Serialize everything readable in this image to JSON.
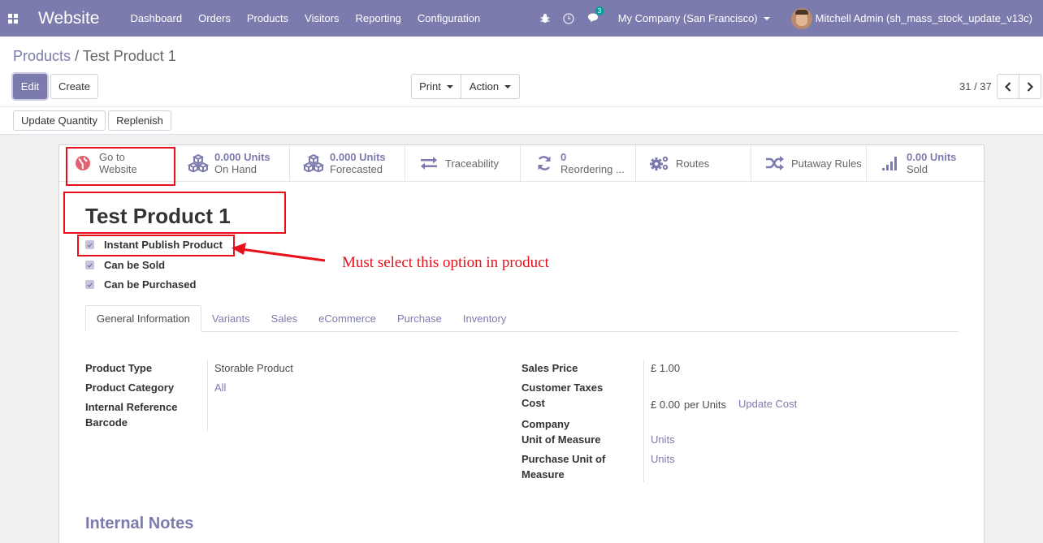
{
  "navbar": {
    "brand": "Website",
    "menu": [
      "Dashboard",
      "Orders",
      "Products",
      "Visitors",
      "Reporting",
      "Configuration"
    ],
    "chat_count": "3",
    "company": "My Company (San Francisco)",
    "user": "Mitchell Admin (sh_mass_stock_update_v13c)"
  },
  "breadcrumb": {
    "parent": "Products",
    "separator": "/",
    "current": "Test Product 1"
  },
  "toolbar": {
    "edit": "Edit",
    "create": "Create",
    "print": "Print",
    "action": "Action",
    "pager": "31 / 37",
    "update_quantity": "Update Quantity",
    "replenish": "Replenish"
  },
  "stats": [
    {
      "line1": "Go to",
      "line2": "Website",
      "icon": "globe-icon"
    },
    {
      "line1": "0.000 Units",
      "line2": "On Hand",
      "icon": "cubes-icon"
    },
    {
      "line1": "0.000 Units",
      "line2": "Forecasted",
      "icon": "cubes-icon"
    },
    {
      "line1": "Traceability",
      "line2": "",
      "icon": "exchange-icon"
    },
    {
      "line1": "0",
      "line2": "Reordering ...",
      "icon": "refresh-icon"
    },
    {
      "line1": "Routes",
      "line2": "",
      "icon": "cogs-icon"
    },
    {
      "line1": "Putaway Rules",
      "line2": "",
      "icon": "random-icon"
    },
    {
      "line1": "0.00 Units",
      "line2": "Sold",
      "icon": "signal-icon"
    }
  ],
  "product": {
    "name": "Test Product 1",
    "checkboxes": [
      "Instant Publish Product",
      "Can be Sold",
      "Can be Purchased"
    ]
  },
  "annotation": "Must select this option in product",
  "tabs": [
    "General Information",
    "Variants",
    "Sales",
    "eCommerce",
    "Purchase",
    "Inventory"
  ],
  "left_fields": {
    "product_type_label": "Product Type",
    "product_type": "Storable Product",
    "category_label": "Product Category",
    "category": "All",
    "internal_ref_label": "Internal Reference",
    "barcode_label": "Barcode"
  },
  "right_fields": {
    "sales_price_label": "Sales Price",
    "sales_price": "£ 1.00",
    "customer_taxes_label": "Customer Taxes",
    "cost_label": "Cost",
    "cost": "£ 0.00",
    "cost_unit": "per Units",
    "update_cost": "Update Cost",
    "company_label": "Company",
    "uom_label": "Unit of Measure",
    "uom": "Units",
    "purchase_uom_label_1": "Purchase Unit of",
    "purchase_uom_label_2": "Measure",
    "purchase_uom": "Units"
  },
  "notes_title": "Internal Notes",
  "colors": {
    "primary": "#7c7bad",
    "highlight": "#e8101a"
  }
}
